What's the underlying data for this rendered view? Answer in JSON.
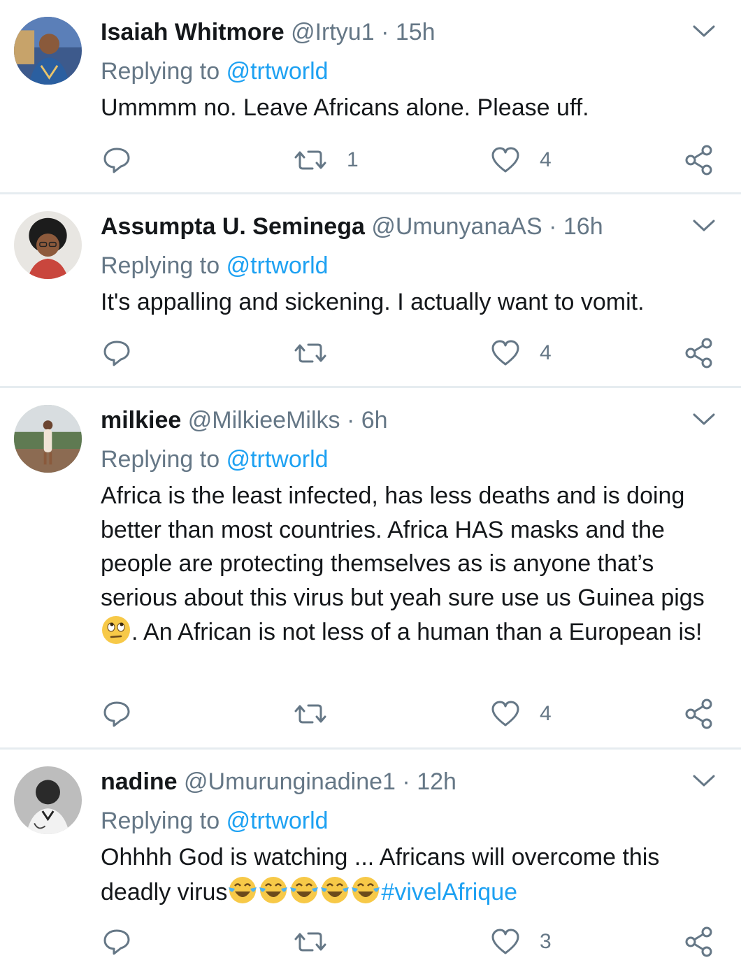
{
  "reply_prefix": "Replying to",
  "tweets": [
    {
      "name": "Isaiah Whitmore",
      "handle": "@Irtyu1",
      "separator": "·",
      "time": "15h",
      "replying_to": "@trtworld",
      "text": "Ummmm no. Leave Africans alone. Please uff.",
      "retweets": "1",
      "likes": "4"
    },
    {
      "name": "Assumpta U. Seminega",
      "handle": "@UmunyanaAS",
      "separator": "·",
      "time": "16h",
      "replying_to": "@trtworld",
      "text": "It's appalling and sickening. I actually want to vomit.",
      "retweets": "",
      "likes": "4"
    },
    {
      "name": "milkiee",
      "handle": "@MilkieeMilks",
      "separator": "·",
      "time": "6h",
      "replying_to": "@trtworld",
      "text_a": "Africa is the least infected, has less deaths and is doing better than most countries. Africa HAS masks and the people are protecting themselves as is anyone that’s serious about this virus but yeah sure use us Guinea pigs",
      "text_b": ". An African is not less of a human than a European is!",
      "emoji": "face-with-rolling-eyes",
      "retweets": "",
      "likes": "4"
    },
    {
      "name": "nadine",
      "handle": "@Umurunginadine1",
      "separator": "·",
      "time": "12h",
      "replying_to": "@trtworld",
      "text": "Ohhhh God is watching ... Africans will overcome this deadly virus",
      "emoji": "face-with-tears-of-joy",
      "emoji_count": 5,
      "hashtag": "#vivelAfrique",
      "retweets": "",
      "likes": "3"
    }
  ],
  "colors": {
    "primary_text": "#14171a",
    "secondary_text": "#657786",
    "link": "#1da1f2",
    "divider": "#e6ecf0"
  },
  "icons": [
    "reply-icon",
    "retweet-icon",
    "like-icon",
    "share-icon",
    "chevron-down-icon"
  ]
}
